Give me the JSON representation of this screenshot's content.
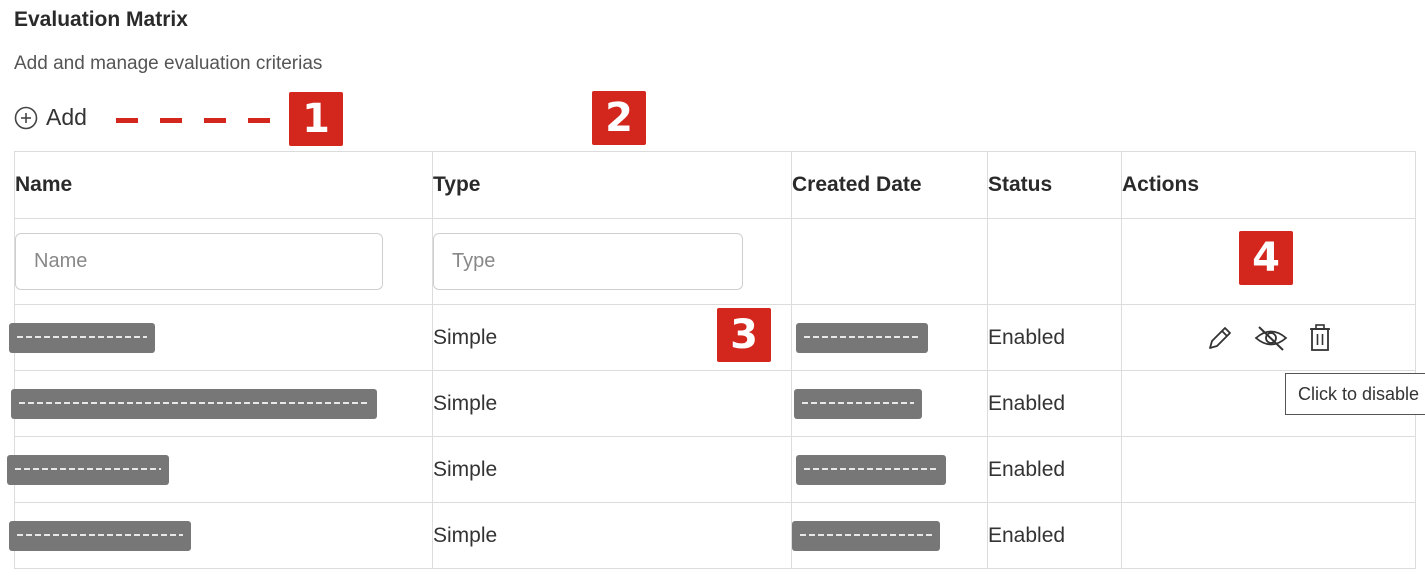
{
  "header": {
    "title": "Evaluation Matrix",
    "subtitle": "Add and manage evaluation criterias"
  },
  "toolbar": {
    "add_label": "Add",
    "add_icon": "plus-circle-icon"
  },
  "markers": [
    "1",
    "2",
    "3",
    "4"
  ],
  "table": {
    "columns": [
      "Name",
      "Type",
      "Created Date",
      "Status",
      "Actions"
    ],
    "filters": {
      "name_placeholder": "Name",
      "type_placeholder": "Type"
    },
    "rows": [
      {
        "type": "Simple",
        "status": "Enabled"
      },
      {
        "type": "Simple",
        "status": "Enabled"
      },
      {
        "type": "Simple",
        "status": "Enabled"
      },
      {
        "type": "Simple",
        "status": "Enabled"
      }
    ],
    "row_actions": [
      "edit-icon",
      "hide-icon",
      "delete-icon"
    ]
  },
  "tooltip": {
    "text": "Click to disable"
  },
  "colors": {
    "marker": "#d3261c",
    "redaction": "#777777",
    "border": "#dcdcdc"
  }
}
